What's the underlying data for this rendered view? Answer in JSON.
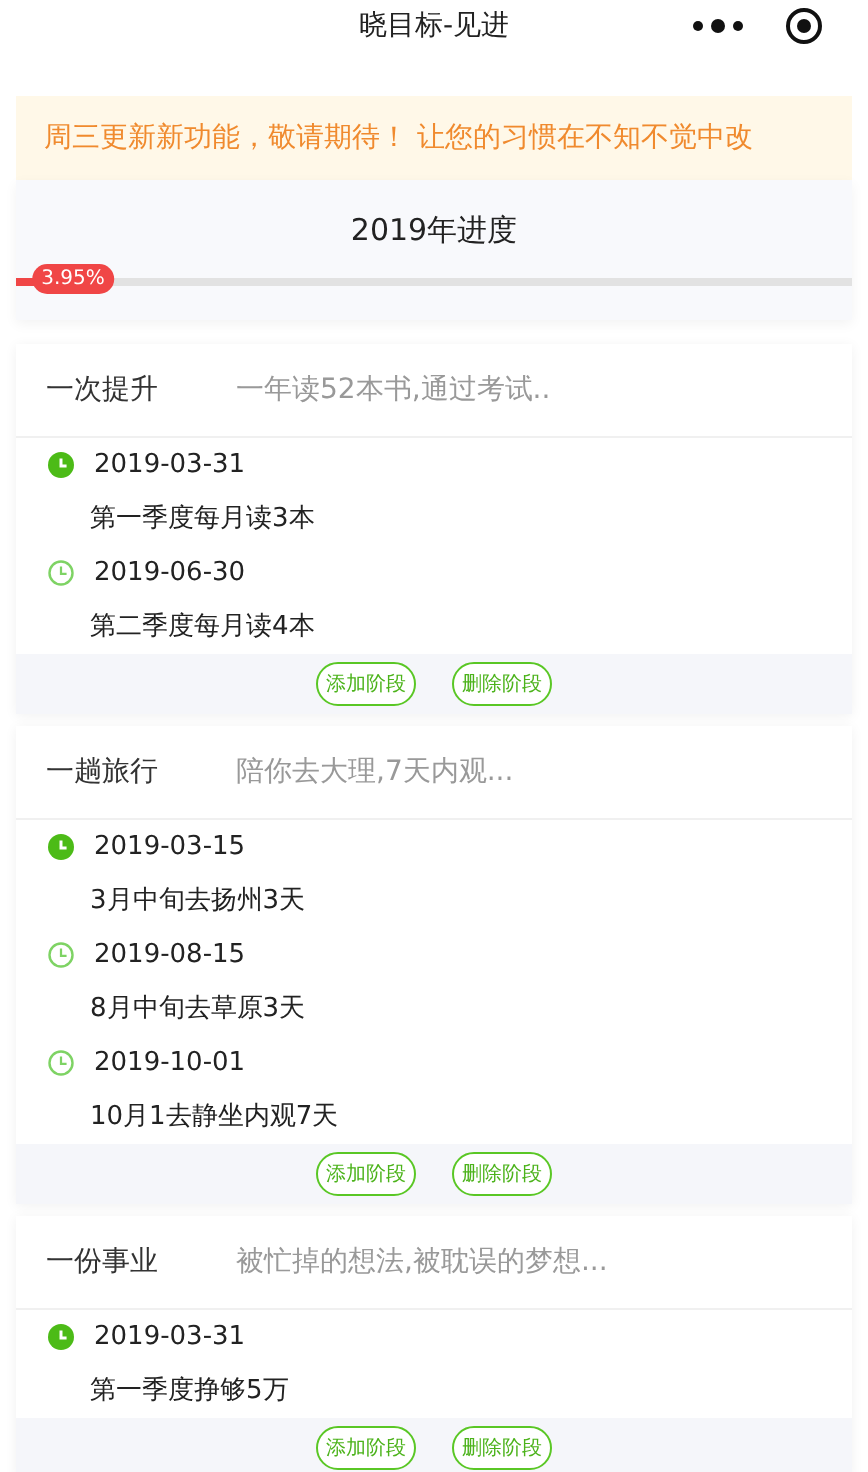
{
  "window": {
    "title": "晓目标-见进"
  },
  "notice": "周三更新新功能，敬请期待！ 让您的习惯在不知不觉中改",
  "progress": {
    "title": "2019年进度",
    "level": 0.0395,
    "reading": "3.95%"
  },
  "goals": [
    {
      "title": "一次提升",
      "summary": "一年读52本书,通过考试..",
      "stages": [
        {
          "date": "2019-03-31",
          "text": "第一季度每月读3本",
          "done": true
        },
        {
          "date": "2019-06-30",
          "text": "第二季度每月读4本",
          "done": false
        }
      ],
      "buttons": [
        "添加阶段",
        "删除阶段"
      ]
    },
    {
      "title": "一趟旅行",
      "summary": "陪你去大理,7天内观...",
      "stages": [
        {
          "date": "2019-03-15",
          "text": "3月中旬去扬州3天",
          "done": true
        },
        {
          "date": "2019-08-15",
          "text": "8月中旬去草原3天",
          "done": false
        },
        {
          "date": "2019-10-01",
          "text": "10月1去静坐内观7天",
          "done": false
        }
      ],
      "buttons": [
        "添加阶段",
        "删除阶段"
      ]
    },
    {
      "title": "一份事业",
      "summary": "被忙掉的想法,被耽误的梦想...",
      "stages": [
        {
          "date": "2019-03-31",
          "text": "第一季度挣够5万",
          "done": true
        }
      ],
      "buttons": [
        "添加阶段",
        "删除阶段"
      ]
    }
  ]
}
